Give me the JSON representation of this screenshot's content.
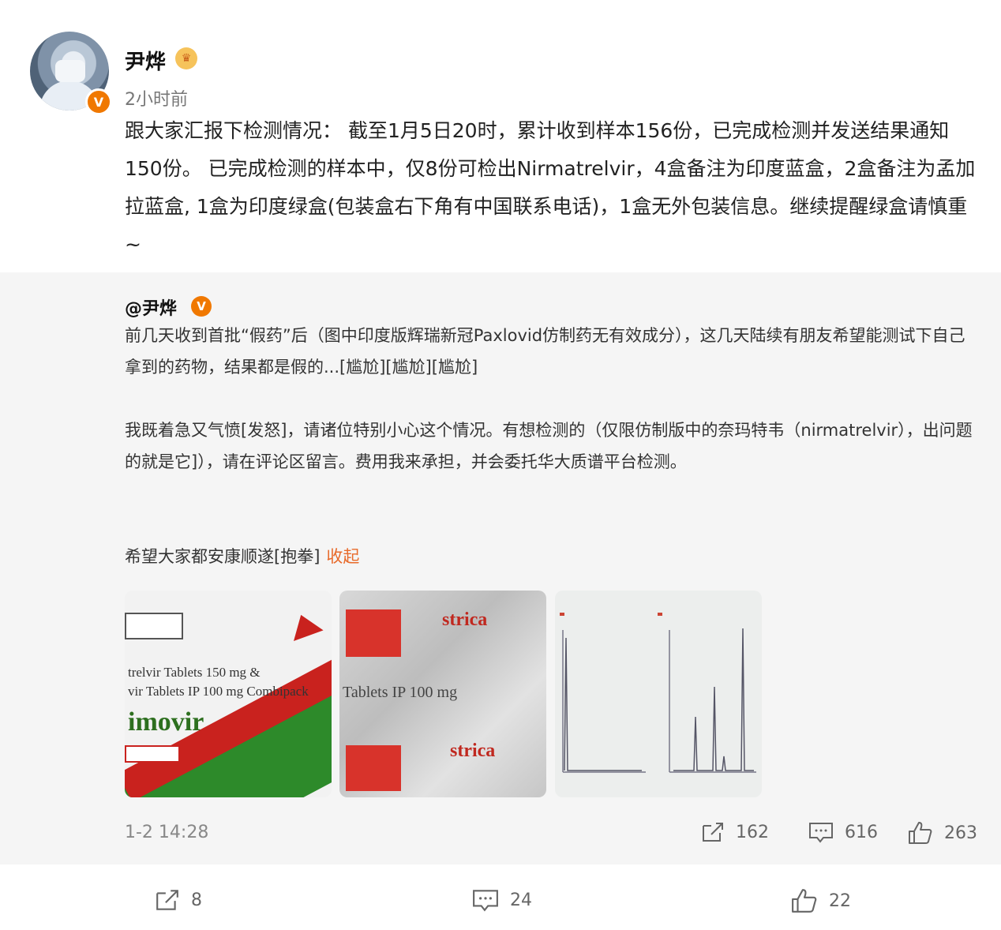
{
  "post": {
    "author": "尹烨",
    "time": "2小时前",
    "text": "跟大家汇报下检测情况： 截至1月5日20时，累计收到样本156份，已完成检测并发送结果通知150份。 已完成检测的样本中，仅8份可检出Nirmatrelvir，4盒备注为印度蓝盒，2盒备注为孟加拉蓝盒, 1盒为印度绿盒(包装盒右下角有中国联系电话)，1盒无外包装信息。继续提醒绿盒请慎重~"
  },
  "repost": {
    "author": "@尹烨",
    "para1": "前几天收到首批“假药”后（图中印度版辉瑞新冠Paxlovid仿制药无有效成分），这几天陆续有朋友希望能测试下自己拿到的药物，结果都是假的...[尴尬][尴尬][尴尬]",
    "para2": "我既着急又气愤[发怒]，请诸位特别小心这个情况。有想检测的（仅限仿制版中的奈玛特韦（nirmatrelvir），出问题的就是它]），请在评论区留言。费用我来承担，并会委托华大质谱平台检测。",
    "para3": "希望大家都安康顺遂[抱拳]",
    "collapse_label": "收起",
    "time": "1-2 14:28",
    "reposts": "162",
    "comments": "616",
    "likes": "263",
    "images": {
      "img1": {
        "line1": "trelvir Tablets 150 mg &",
        "line2": "vir Tablets IP 100 mg Combipack",
        "name": "imovir"
      },
      "img2": {
        "brand": "strica",
        "ip": "Tablets IP 100 mg"
      }
    }
  },
  "footer": {
    "reposts": "8",
    "comments": "24",
    "likes": "22"
  },
  "colors": {
    "accent": "#e86a2a",
    "verified": "#f07800",
    "muted": "#888888"
  }
}
